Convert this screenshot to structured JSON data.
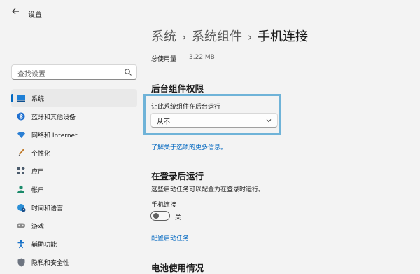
{
  "window": {
    "title": "设置"
  },
  "search": {
    "placeholder": "查找设置"
  },
  "sidebar": {
    "items": [
      {
        "label": "系统",
        "icon": "system-icon",
        "active": true
      },
      {
        "label": "蓝牙和其他设备",
        "icon": "bluetooth-icon"
      },
      {
        "label": "网络和 Internet",
        "icon": "wifi-icon"
      },
      {
        "label": "个性化",
        "icon": "brush-icon"
      },
      {
        "label": "应用",
        "icon": "apps-icon"
      },
      {
        "label": "帐户",
        "icon": "account-icon"
      },
      {
        "label": "时间和语言",
        "icon": "globe-clock-icon"
      },
      {
        "label": "游戏",
        "icon": "gamepad-icon"
      },
      {
        "label": "辅助功能",
        "icon": "accessibility-icon"
      },
      {
        "label": "隐私和安全性",
        "icon": "shield-icon"
      }
    ]
  },
  "breadcrumb": {
    "level1": "系统",
    "level2": "系统组件",
    "current": "手机连接",
    "separator": "›"
  },
  "usage": {
    "label": "总使用量",
    "value": "3.22 MB"
  },
  "background_permissions": {
    "title": "后台组件权限",
    "label": "让此系统组件在后台运行",
    "selected": "从不",
    "link": "了解关于选项的更多信息。"
  },
  "startup": {
    "title": "在登录后运行",
    "description": "这些启动任务可以配置为在登录时运行。",
    "task_label": "手机连接",
    "toggle_state": "关",
    "toggle_on": false,
    "link": "配置启动任务"
  },
  "battery": {
    "title": "电池使用情况"
  },
  "colors": {
    "accent": "#0067c0",
    "focus": "#6fb3d8"
  }
}
